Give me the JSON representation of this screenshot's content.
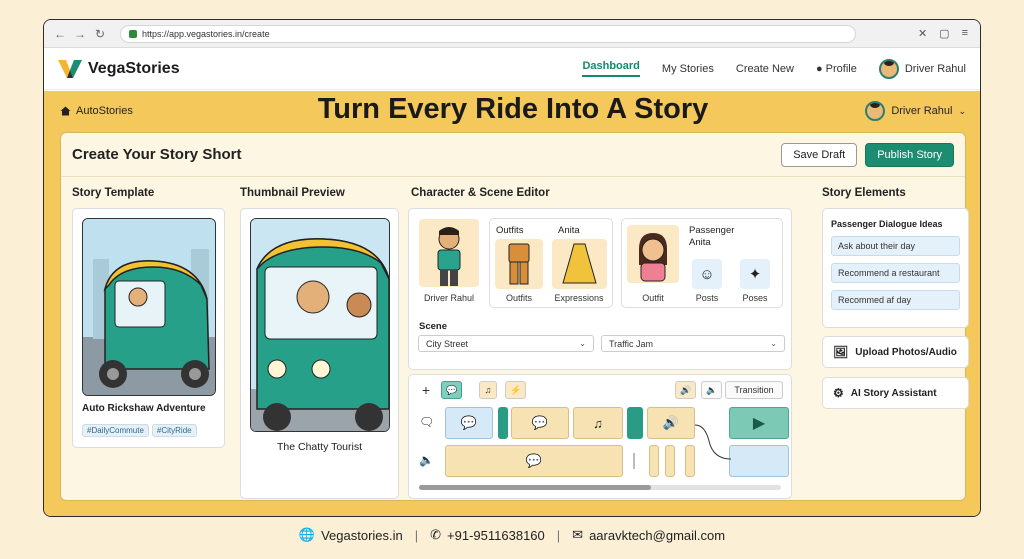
{
  "browser": {
    "url": "https://app.vegastories.in/create"
  },
  "app": {
    "name": "VegaStories"
  },
  "nav": {
    "links": [
      "Dashboard",
      "My Stories",
      "Create New"
    ],
    "profile": "Profile",
    "user": "Driver Rahul"
  },
  "banner": {
    "crumb": "AutoStories",
    "title": "Turn Every Ride Into A Story",
    "user": "Driver Rahul"
  },
  "panel": {
    "title": "Create Your Story Short",
    "save_draft": "Save Draft",
    "publish": "Publish Story"
  },
  "template": {
    "heading": "Story Template",
    "name": "Auto Rickshaw Adventure",
    "tags": [
      "#DailyCommute",
      "#CityRide"
    ]
  },
  "thumbnail": {
    "heading": "Thumbnail Preview",
    "caption": "The Chatty Tourist"
  },
  "editor": {
    "heading": "Character & Scene Editor",
    "driver": "Driver Rahul",
    "outfits_header": "Outfits",
    "anita_header": "Anita",
    "outfits_label": "Outfits",
    "expressions_label": "Expressions",
    "passenger_header": "Passenger",
    "passenger_name": "Anita",
    "outfit_label": "Outfit",
    "posts_label": "Posts",
    "poses_label": "Poses",
    "scene_label": "Scene",
    "scene_value": "City Street",
    "scene2_value": "Traffic Jam",
    "transition": "Transition"
  },
  "elements": {
    "heading": "Story Elements",
    "ideas_title": "Passenger Dialogue Ideas",
    "ideas": [
      "Ask about their day",
      "Recommend a restaurant",
      "Recommed af day"
    ],
    "upload": "Upload Photos/Audio",
    "assistant": "AI Story Assistant"
  },
  "footer": {
    "site": "Vegastories.in",
    "phone": "+91-9511638160",
    "email": "aaravktech@gmail.com"
  },
  "colors": {
    "accent": "#1c8d70",
    "banner": "#f5c85c",
    "background": "#fbefd6"
  }
}
